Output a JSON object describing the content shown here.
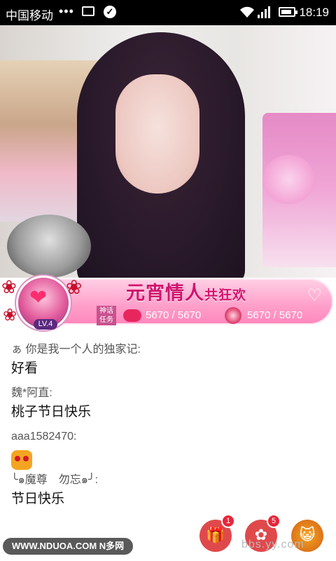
{
  "status_bar": {
    "carrier": "中国移动",
    "dots": "•••",
    "time": "18:19"
  },
  "banner": {
    "title_main": "元宵情人",
    "title_sub": "共狂欢",
    "mission_label": "神话任务",
    "level": "LV.4",
    "counter1": "5670 / 5670",
    "counter2": "5670 / 5670",
    "colors": {
      "accent": "#d2136e",
      "bar": "#ff9fca"
    }
  },
  "chat": {
    "messages": [
      {
        "user": "ぁ 你是我一个人的独家记:",
        "text": "好看"
      },
      {
        "user": "魏*阿直:",
        "text": "桃子节日快乐"
      },
      {
        "user": "aaa1582470:",
        "emote": "cat-emote-icon"
      },
      {
        "user": "╰๑魔尊　勿忘๑╯:",
        "text": "节日快乐"
      }
    ]
  },
  "bottom": {
    "watermark": "WWW.NDUOA.COM N多网",
    "gift_count": "1",
    "flower_count": "5",
    "bbs_text": "bbs.yy.com"
  }
}
